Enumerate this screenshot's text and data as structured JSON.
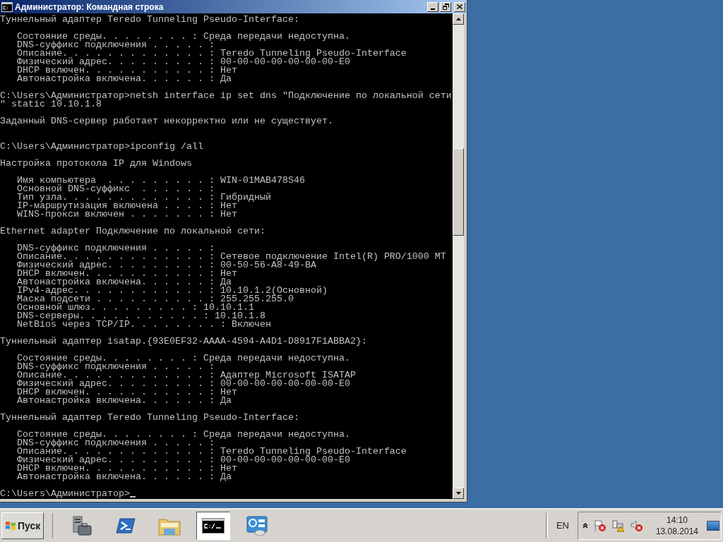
{
  "window": {
    "title": "Администратор: Командная строка"
  },
  "console": {
    "lines": [
      {
        "kind": "text",
        "text": "Туннельный адаптер Teredo Tunneling Pseudo-Interface:"
      },
      {
        "kind": "blank"
      },
      {
        "kind": "text",
        "text": "   Состояние среды. . . . . . . . : Среда передачи недоступна."
      },
      {
        "kind": "text",
        "text": "   DNS-суффикс подключения . . . . . :"
      },
      {
        "kind": "text",
        "text": "   Описание. . . . . . . . . . . . . : Teredo Tunneling Pseudo-Interface"
      },
      {
        "kind": "text",
        "text": "   Физический адрес. . . . . . . . . : 00-00-00-00-00-00-00-E0"
      },
      {
        "kind": "text",
        "text": "   DHCP включен. . . . . . . . . . . : Нет"
      },
      {
        "kind": "text",
        "text": "   Автонастройка включена. . . . . . : Да"
      },
      {
        "kind": "blank"
      },
      {
        "kind": "text",
        "text": "C:\\Users\\Администратор>netsh interface ip set dns \"Подключение по локальной сети"
      },
      {
        "kind": "text",
        "text": "\" static 10.10.1.8"
      },
      {
        "kind": "blank"
      },
      {
        "kind": "text",
        "text": "Заданный DNS-сервер работает некорректно или не существует."
      },
      {
        "kind": "blank"
      },
      {
        "kind": "blank"
      },
      {
        "kind": "text",
        "text": "C:\\Users\\Администратор>ipconfig /all"
      },
      {
        "kind": "blank"
      },
      {
        "kind": "text",
        "text": "Настройка протокола IP для Windows"
      },
      {
        "kind": "blank"
      },
      {
        "kind": "text",
        "text": "   Имя компьютера  . . . . . . . . . : WIN-01MAB478S46"
      },
      {
        "kind": "text",
        "text": "   Основной DNS-суффикс  . . . . . . :"
      },
      {
        "kind": "text",
        "text": "   Тип узла. . . . . . . . . . . . . : Гибридный"
      },
      {
        "kind": "text",
        "text": "   IP-маршрутизация включена . . . . : Нет"
      },
      {
        "kind": "text",
        "text": "   WINS-прокси включен . . . . . . . : Нет"
      },
      {
        "kind": "blank"
      },
      {
        "kind": "text",
        "text": "Ethernet adapter Подключение по локальной сети:"
      },
      {
        "kind": "blank"
      },
      {
        "kind": "text",
        "text": "   DNS-суффикс подключения . . . . . :"
      },
      {
        "kind": "text",
        "text": "   Описание. . . . . . . . . . . . . : Сетевое подключение Intel(R) PRO/1000 MT"
      },
      {
        "kind": "text",
        "text": "   Физический адрес. . . . . . . . . : 00-50-56-A8-49-BA"
      },
      {
        "kind": "text",
        "text": "   DHCP включен. . . . . . . . . . . : Нет"
      },
      {
        "kind": "text",
        "text": "   Автонастройка включена. . . . . . : Да"
      },
      {
        "kind": "text",
        "text": "   IPv4-адрес. . . . . . . . . . . . : 10.10.1.2(Основной)"
      },
      {
        "kind": "text",
        "text": "   Маска подсети . . . . . . . . . . : 255.255.255.0"
      },
      {
        "kind": "text",
        "text": "   Основной шлюз. . . . . . . . . : 10.10.1.1"
      },
      {
        "kind": "text",
        "text": "   DNS-серверы. . . . . . . . . . . : 10.10.1.8"
      },
      {
        "kind": "text",
        "text": "   NetBios через TCP/IP. . . . . . . . : Включен"
      },
      {
        "kind": "blank"
      },
      {
        "kind": "text",
        "text": "Туннельный адаптер isatap.{93E0EF32-AAAA-4594-A4D1-D8917F1ABBA2}:"
      },
      {
        "kind": "blank"
      },
      {
        "kind": "text",
        "text": "   Состояние среды. . . . . . . . : Среда передачи недоступна."
      },
      {
        "kind": "text",
        "text": "   DNS-суффикс подключения . . . . . :"
      },
      {
        "kind": "text",
        "text": "   Описание. . . . . . . . . . . . . : Адаптер Microsoft ISATAP"
      },
      {
        "kind": "text",
        "text": "   Физический адрес. . . . . . . . . : 00-00-00-00-00-00-00-E0"
      },
      {
        "kind": "text",
        "text": "   DHCP включен. . . . . . . . . . . : Нет"
      },
      {
        "kind": "text",
        "text": "   Автонастройка включена. . . . . . : Да"
      },
      {
        "kind": "blank"
      },
      {
        "kind": "text",
        "text": "Туннельный адаптер Teredo Tunneling Pseudo-Interface:"
      },
      {
        "kind": "blank"
      },
      {
        "kind": "text",
        "text": "   Состояние среды. . . . . . . . : Среда передачи недоступна."
      },
      {
        "kind": "text",
        "text": "   DNS-суффикс подключения . . . . . :"
      },
      {
        "kind": "text",
        "text": "   Описание. . . . . . . . . . . . . : Teredo Tunneling Pseudo-Interface"
      },
      {
        "kind": "text",
        "text": "   Физический адрес. . . . . . . . . : 00-00-00-00-00-00-00-E0"
      },
      {
        "kind": "text",
        "text": "   DHCP включен. . . . . . . . . . . : Нет"
      },
      {
        "kind": "text",
        "text": "   Автонастройка включена. . . . . . : Да"
      },
      {
        "kind": "blank"
      },
      {
        "kind": "prompt",
        "text": "C:\\Users\\Администратор>"
      }
    ]
  },
  "taskbar": {
    "start": "Пуск",
    "apps": [
      {
        "kind": "server",
        "selected": false
      },
      {
        "kind": "powershell",
        "selected": false
      },
      {
        "kind": "folder",
        "selected": false
      },
      {
        "kind": "console",
        "selected": true
      },
      {
        "kind": "panel",
        "selected": false
      }
    ],
    "language": "EN",
    "clock": {
      "time": "14:10",
      "date": "13.08.2014"
    }
  }
}
